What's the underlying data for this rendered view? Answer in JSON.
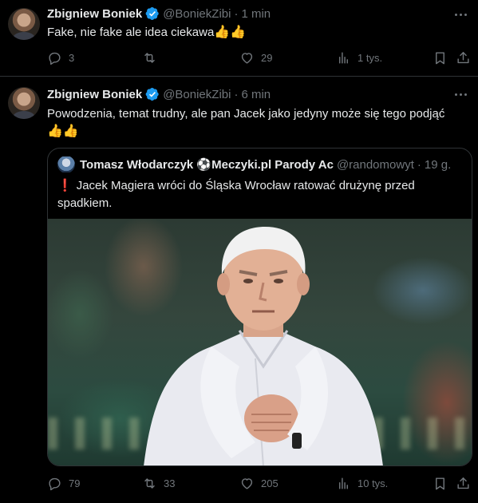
{
  "tweet1": {
    "name": "Zbigniew Boniek",
    "handle": "@BoniekZibi",
    "separator": "·",
    "time": "1 min",
    "text": "Fake, nie fake ale idea ciekawa",
    "emojis": "👍👍",
    "replies": "3",
    "reposts": "",
    "likes": "29",
    "views": "1 tys."
  },
  "tweet2": {
    "name": "Zbigniew Boniek",
    "handle": "@BoniekZibi",
    "separator": "·",
    "time": "6 min",
    "text": "Powodzenia, temat trudny, ale pan Jacek jako jedyny może się tego podjąć",
    "emojis": "👍👍",
    "replies": "79",
    "reposts": "33",
    "likes": "205",
    "views": "10 tys.",
    "quote": {
      "name": "Tomasz Włodarczyk ⚽Meczyki.pl Parody Ac",
      "handle": "@randomowyt",
      "separator": "·",
      "time": "19 g.",
      "exclamation": "❗",
      "text": "Jacek Magiera wróci do Śląska Wrocław ratować drużynę przed spadkiem."
    }
  },
  "icons": [
    "verified-badge-icon",
    "more-icon",
    "reply-icon",
    "repost-icon",
    "like-icon",
    "views-icon",
    "bookmark-icon",
    "share-icon"
  ],
  "colors": {
    "background": "#000000",
    "text": "#e7e9ea",
    "muted": "#71767b",
    "verified": "#1d9bf0",
    "border": "#2f3336"
  }
}
